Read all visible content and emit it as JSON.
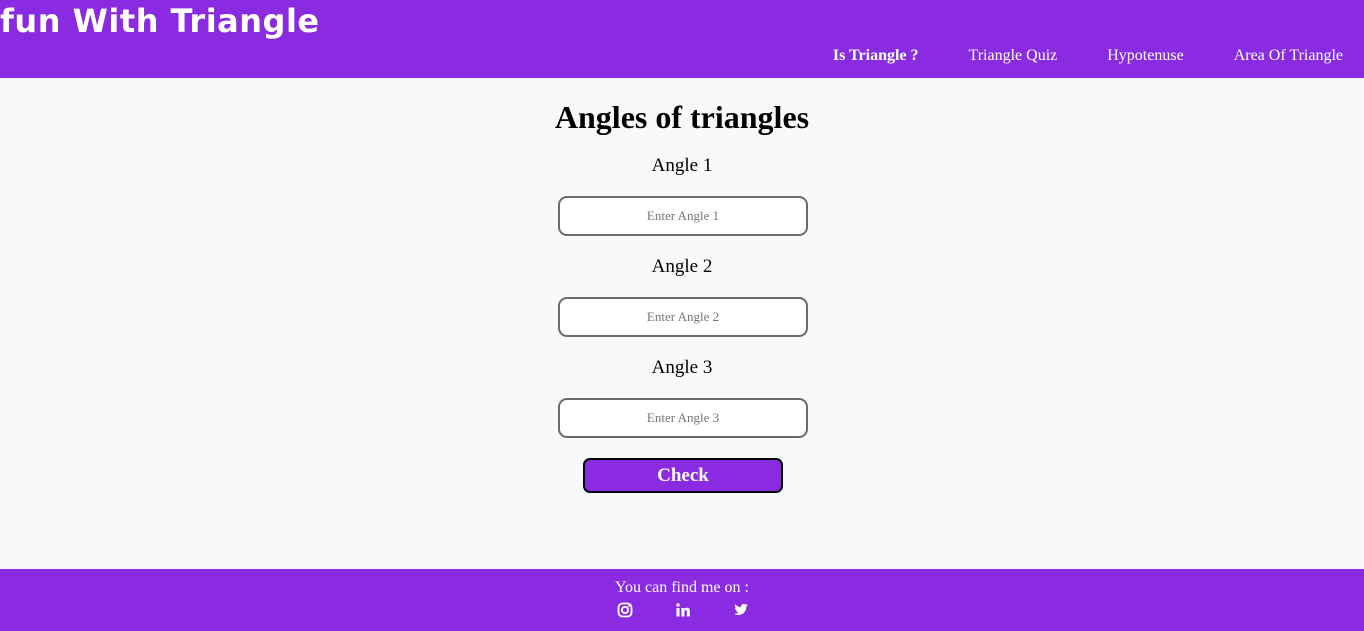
{
  "header": {
    "brand": "fun With Triangle",
    "nav": [
      {
        "label": "Is Triangle ?",
        "active": true
      },
      {
        "label": "Triangle Quiz",
        "active": false
      },
      {
        "label": "Hypotenuse",
        "active": false
      },
      {
        "label": "Area Of Triangle",
        "active": false
      }
    ]
  },
  "main": {
    "title": "Angles of triangles",
    "fields": [
      {
        "label": "Angle 1",
        "placeholder": "Enter Angle 1",
        "value": ""
      },
      {
        "label": "Angle 2",
        "placeholder": "Enter Angle 2",
        "value": ""
      },
      {
        "label": "Angle 3",
        "placeholder": "Enter Angle 3",
        "value": ""
      }
    ],
    "check_label": "Check"
  },
  "footer": {
    "text": "You can find me on :",
    "social": [
      "instagram-icon",
      "linkedin-icon",
      "twitter-icon"
    ]
  },
  "colors": {
    "primary": "#8a2be2",
    "background": "#f8f9fb",
    "text": "#000000"
  }
}
